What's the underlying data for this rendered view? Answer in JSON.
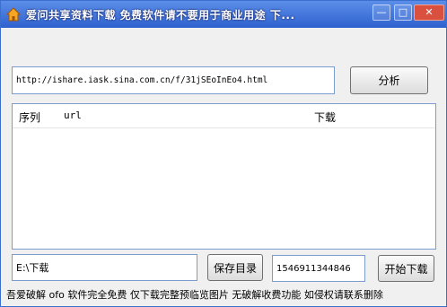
{
  "window": {
    "title": "爱问共享资料下载 免费软件请不要用于商业用途 下...",
    "minimize_label": "—",
    "maximize_label": "□",
    "close_label": "✕"
  },
  "url_input": {
    "value": "http://ishare.iask.sina.com.cn/f/31jSEoInEo4.html"
  },
  "buttons": {
    "analyze": "分析",
    "save_dir": "保存目录",
    "start_download": "开始下载"
  },
  "table": {
    "columns": [
      "序列",
      "url",
      "下载"
    ]
  },
  "save_path": {
    "value": "E:\\下载"
  },
  "timestamp_field": {
    "value": "1546911344846"
  },
  "status_text": "吾爱破解 ofo 软件完全免费 仅下载完整预临览图片 无破解收费功能 如侵权请联系删除",
  "icons": {
    "app": "house-icon"
  }
}
